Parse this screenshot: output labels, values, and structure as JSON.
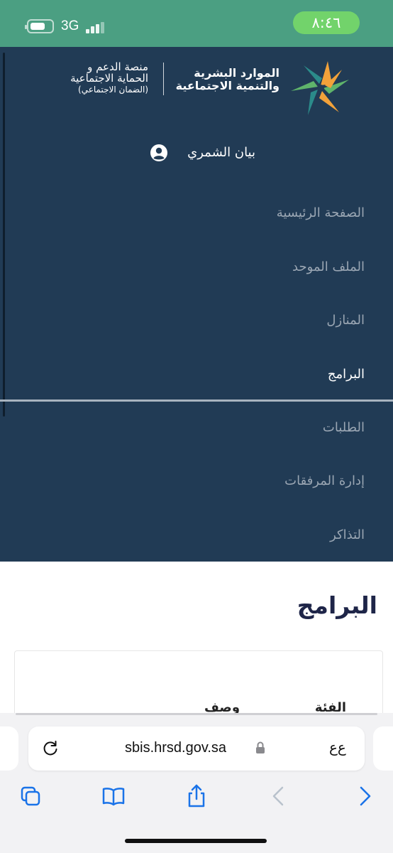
{
  "status_bar": {
    "time": "٨:٤٦",
    "network": "3G",
    "battery_level": 0.6,
    "colors": {
      "background": "#4b9f82",
      "time_pill": "#72d36b"
    }
  },
  "header": {
    "platform_line1": "منصة الدعم و",
    "platform_line2": "الحماية الاجتماعية",
    "platform_line3": "(الضمان الاجتماعي)",
    "ministry_line1": "الموارد البشرية",
    "ministry_line2": "والتنمية الاجتماعية",
    "logo_icon": "hrsd-star-logo"
  },
  "user": {
    "name": "بيان الشمري",
    "icon": "user-circle-icon"
  },
  "menu": {
    "items": [
      {
        "label": "الصفحة الرئيسية",
        "active": false
      },
      {
        "label": "الملف الموحد",
        "active": false
      },
      {
        "label": "المنازل",
        "active": false
      },
      {
        "label": "البرامج",
        "active": true
      },
      {
        "label": "الطلبات",
        "active": false
      },
      {
        "label": "إدارة المرفقات",
        "active": false
      },
      {
        "label": "التذاكر",
        "active": false
      }
    ],
    "colors": {
      "panel": "#213b55",
      "inactive": "#9aa6b3",
      "active": "#ffffff"
    }
  },
  "main": {
    "title": "البرامج",
    "table_headers": [
      "الفئة",
      "وصف"
    ]
  },
  "browser": {
    "url": "sbis.hrsd.gov.sa",
    "aa_label": "ﻉﻉ",
    "toolbar_icons": [
      "tabs-icon",
      "bookmarks-icon",
      "share-icon",
      "back-icon",
      "forward-icon"
    ]
  }
}
